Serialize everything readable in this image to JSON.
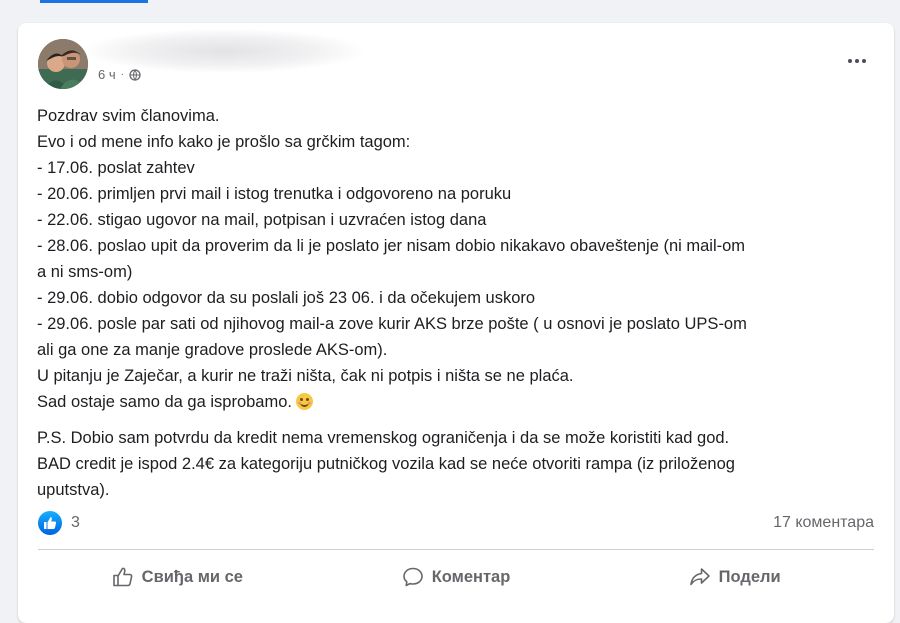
{
  "post": {
    "time": "6 ч",
    "lines": [
      "Pozdrav svim članovima.",
      "Evo i od mene info kako je prošlo sa grčkim tagom:",
      "- 17.06. poslat zahtev",
      "- 20.06. primljen prvi mail i istog trenutka i odgovoreno na poruku",
      "- 22.06. stigao ugovor na mail, potpisan i uzvraćen istog dana",
      "- 28.06. poslao upit da proverim da li je poslato jer nisam dobio nikakavo obaveštenje (ni mail-om",
      "a ni sms-om)",
      "- 29.06. dobio odgovor da su poslali još 23 06. i da očekujem uskoro",
      "- 29.06. posle par sati od njihovog mail-a zove kurir AKS brze pošte ( u osnovi je poslato UPS-om",
      "ali ga one za manje gradove proslede AKS-om).",
      "U pitanju je Zaječar, a kurir ne traži ništa, čak ni potpis i ništa se ne plaća.",
      "Sad ostaje samo da ga isprobamo."
    ],
    "ps_lines": [
      "P.S. Dobio sam potvrdu da kredit nema vremenskog ograničenja i da se može koristiti kad god.",
      "BAD credit je ispod 2.4€ za kategoriju putničkog vozila kad se neće otvoriti rampa (iz priloženog",
      "uputstva)."
    ]
  },
  "stats": {
    "reactions": "3",
    "comments": "17 коментара"
  },
  "actions": {
    "like": "Свиђа ми се",
    "comment": "Коментар",
    "share": "Подели"
  },
  "icons": {
    "like": "thumbs-up-icon",
    "comment": "comment-bubble-icon",
    "share": "share-arrow-icon",
    "privacy": "globe-icon",
    "menu": "more-dots-icon",
    "emoji": "smiling-face-emoji"
  },
  "colors": {
    "background": "#f0f2f5",
    "card": "#ffffff",
    "text": "#1c1e21",
    "secondary": "#65676b",
    "accent": "#1b74e4"
  }
}
